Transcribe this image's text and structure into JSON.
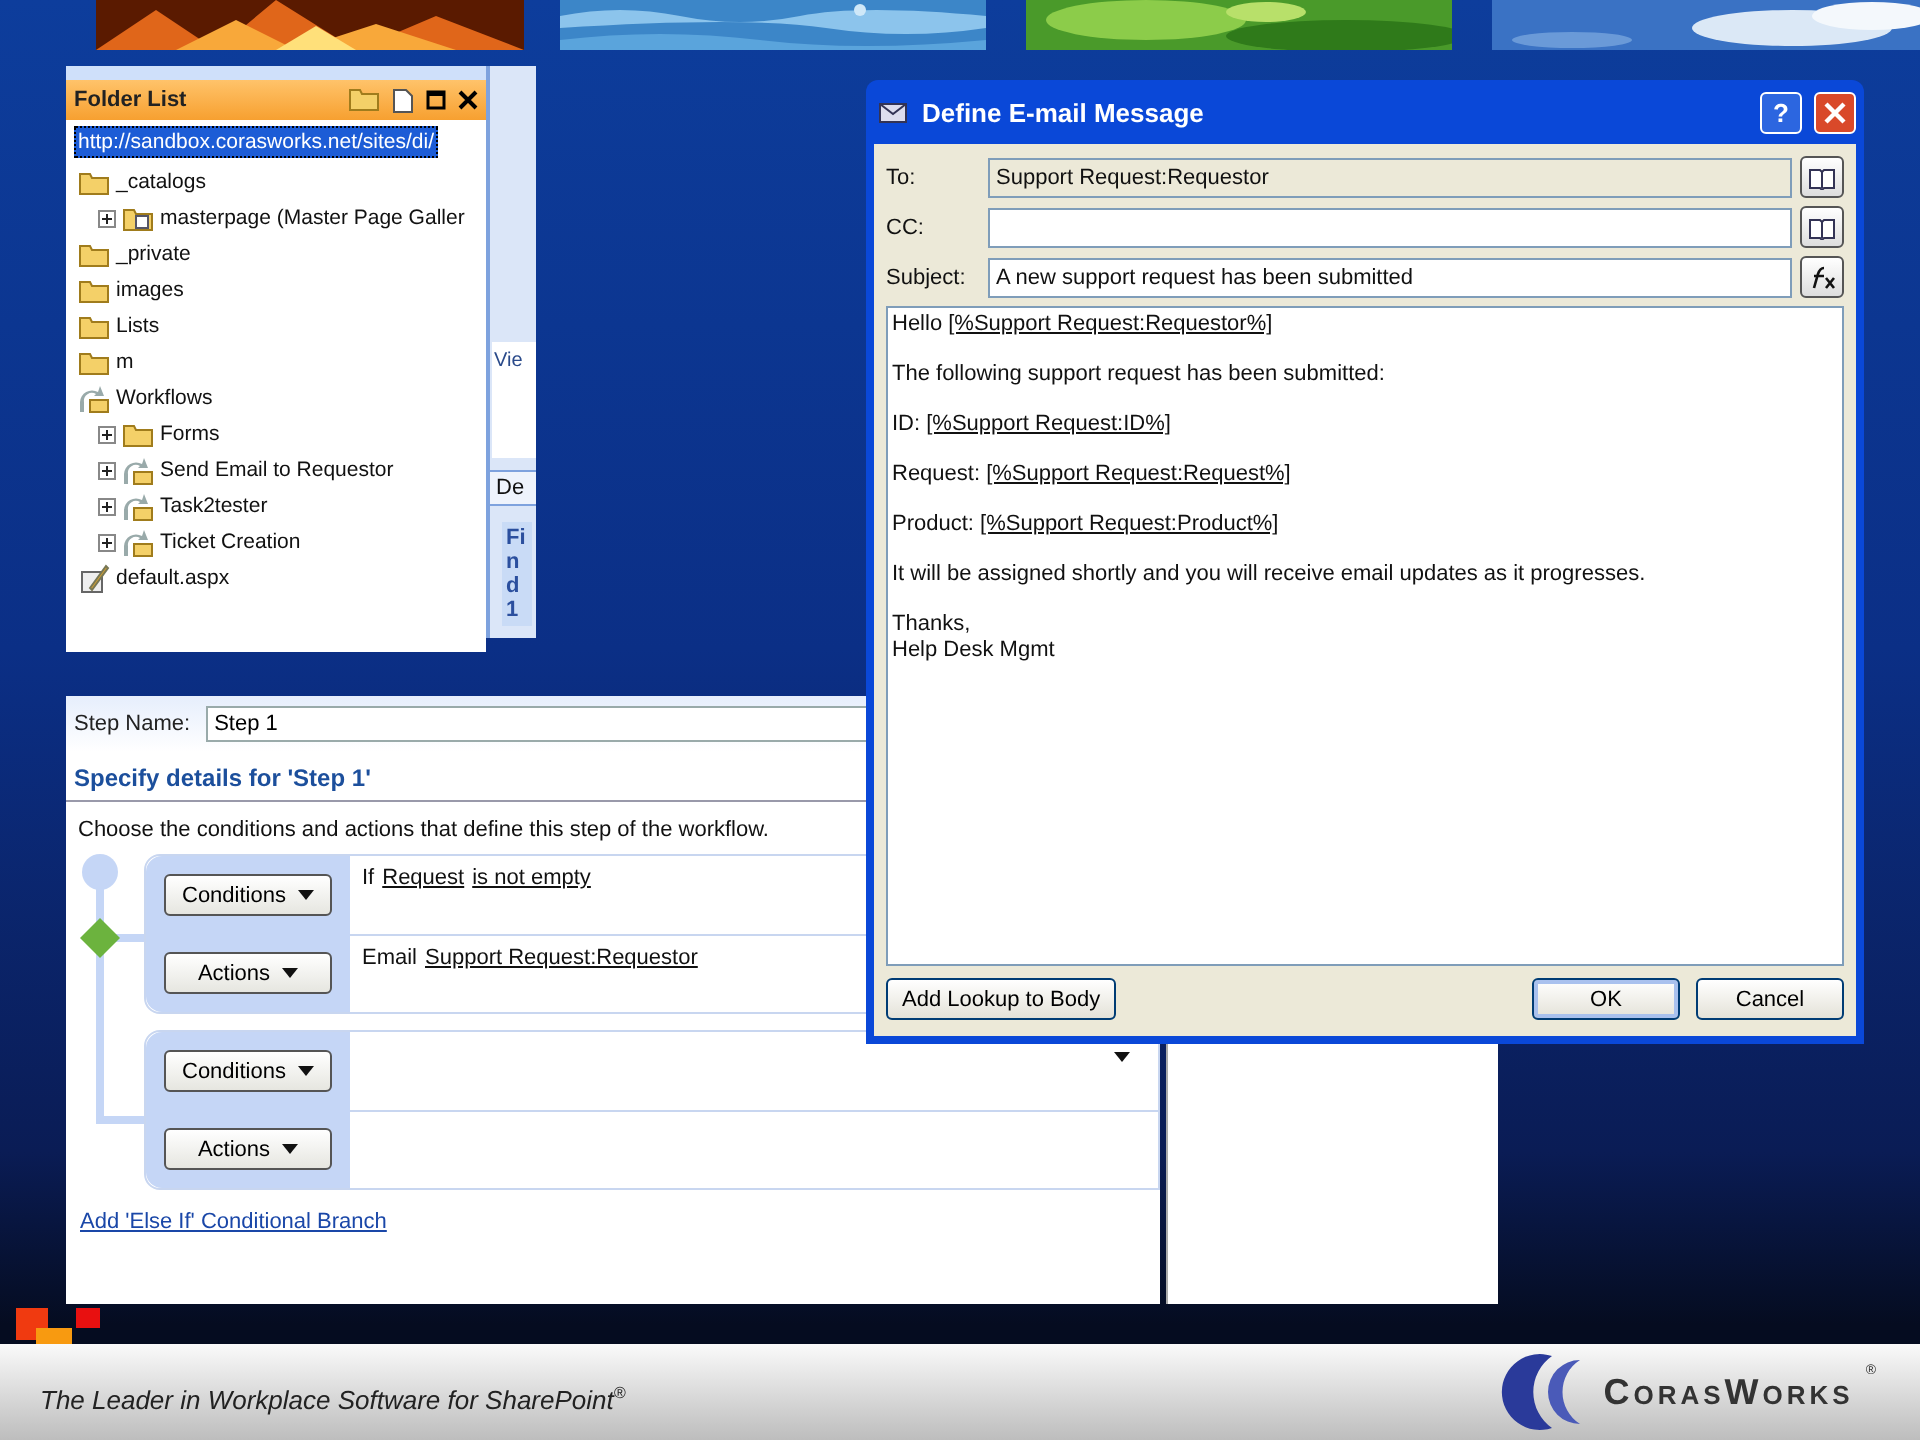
{
  "folder_list": {
    "title": "Folder List",
    "url": "http://sandbox.corasworks.net/sites/di/",
    "items": [
      {
        "label": "_catalogs",
        "kind": "folder",
        "children": [
          {
            "label": "masterpage (Master Page Galler",
            "kind": "library",
            "expanded": false
          }
        ]
      },
      {
        "label": "_private",
        "kind": "folder"
      },
      {
        "label": "images",
        "kind": "folder"
      },
      {
        "label": "Lists",
        "kind": "folder"
      },
      {
        "label": "m",
        "kind": "folder"
      },
      {
        "label": "Workflows",
        "kind": "workflow",
        "children": [
          {
            "label": "Forms",
            "kind": "folder",
            "expanded": false
          },
          {
            "label": "Send Email to Requestor",
            "kind": "workflow",
            "expanded": false
          },
          {
            "label": "Task2tester",
            "kind": "workflow",
            "expanded": false
          },
          {
            "label": "Ticket Creation",
            "kind": "workflow",
            "expanded": false
          }
        ]
      },
      {
        "label": "default.aspx",
        "kind": "page"
      }
    ]
  },
  "side_strip": {
    "tab": "Vie",
    "button": "De",
    "pane_title": "Find 1"
  },
  "workflow": {
    "step_name_label": "Step Name:",
    "step_name": "Step 1",
    "heading": "Specify details for 'Step 1'",
    "instructions": "Choose the conditions and actions that define this step of the workflow.",
    "branches": [
      {
        "conditions_button": "Conditions",
        "actions_button": "Actions",
        "condition": [
          {
            "text": "If",
            "kind": "text"
          },
          {
            "text": "Request",
            "kind": "link"
          },
          {
            "text": "is not empty",
            "kind": "link"
          }
        ],
        "action": [
          {
            "text": "Email",
            "kind": "text"
          },
          {
            "text": "Support Request:Requestor",
            "kind": "link"
          }
        ]
      },
      {
        "conditions_button": "Conditions",
        "actions_button": "Actions"
      }
    ],
    "add_branch_link": "Add 'Else If' Conditional Branch"
  },
  "dialog": {
    "title": "Define E-mail Message",
    "help_button": "?",
    "fields": [
      {
        "label": "To:",
        "value": "Support Request:Requestor",
        "readonly": true,
        "kind": "address"
      },
      {
        "label": "CC:",
        "readonly": false,
        "kind": "address"
      },
      {
        "label": "Subject:",
        "value": "A new support request has been submitted",
        "readonly": false,
        "kind": "formula"
      }
    ],
    "body": [
      [
        {
          "text": "Hello ",
          "kind": "text"
        },
        {
          "text": "[%Support Request:Requestor%]",
          "kind": "lookup"
        }
      ],
      [
        {
          "text": "The following support request has been submitted:",
          "kind": "text"
        }
      ],
      [
        {
          "text": "ID: ",
          "kind": "text"
        },
        {
          "text": "[%Support Request:ID%]",
          "kind": "lookup"
        }
      ],
      [
        {
          "text": "Request:  ",
          "kind": "text"
        },
        {
          "text": "[%Support Request:Request%]",
          "kind": "lookup"
        }
      ],
      [
        {
          "text": "Product:  ",
          "kind": "text"
        },
        {
          "text": "[%Support Request:Product%]",
          "kind": "lookup"
        }
      ],
      [
        {
          "text": "It will be assigned shortly and you will receive email updates as it progresses.",
          "kind": "text"
        }
      ],
      [
        {
          "text": "Thanks,\nHelp Desk Mgmt",
          "kind": "text"
        }
      ]
    ],
    "lookup_button": "Add Lookup to Body",
    "buttons": [
      {
        "label": "OK",
        "default": true
      },
      {
        "label": "Cancel",
        "default": false
      }
    ]
  },
  "footer": {
    "tagline": "The Leader in Workplace Software for SharePoint$^{®}$",
    "brand": "CorasWorks",
    "brand_mark": "®"
  }
}
